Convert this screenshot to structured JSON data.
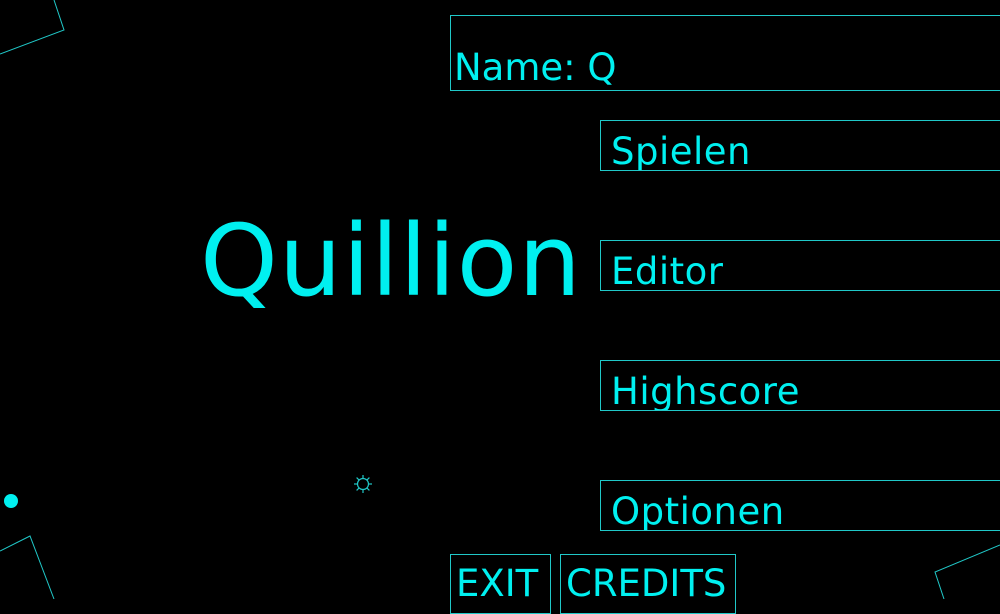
{
  "game": {
    "title": "Quillion",
    "accent_color": "#00f0f0",
    "border_color": "#20c8c8",
    "background_color": "#000000"
  },
  "name_field": {
    "label": "Name: Q"
  },
  "menu": {
    "items": [
      {
        "label": "Spielen"
      },
      {
        "label": "Editor"
      },
      {
        "label": "Highscore"
      },
      {
        "label": "Optionen"
      }
    ]
  },
  "bottom": {
    "exit_label": "EXIT",
    "credits_label": "CREDITS"
  },
  "icons": {
    "gear": "gear-icon",
    "dot": "dot-icon"
  }
}
